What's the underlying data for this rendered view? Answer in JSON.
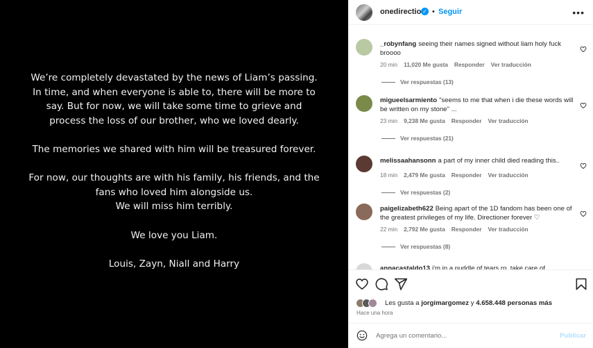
{
  "statement": {
    "paragraphs": [
      [
        "We’re completely devastated by the news of Liam’s passing.",
        "In time, and when everyone is able to, there will be more to",
        "say. But for now, we will take some time to grieve and",
        "process the loss of our brother, who we loved dearly."
      ],
      [
        "The memories we shared with him will be treasured forever."
      ],
      [
        "For now, our thoughts are with his family, his friends, and the",
        "fans who loved him alongside us.",
        "We will miss him terribly."
      ],
      [
        "We love you Liam."
      ],
      [
        "Louis, Zayn, Niall and Harry"
      ]
    ]
  },
  "header": {
    "username": "onedirection",
    "verified_glyph": "✓",
    "separator": "•",
    "follow_label": "Seguir",
    "more_glyph": "•••",
    "verified_color": "#0095f6"
  },
  "comments": [
    {
      "user": "_robynfang",
      "text": "seeing their names signed without liam holy fuck broooo",
      "time": "20 min",
      "likes": "11,020 Me gusta",
      "reply_label": "Responder",
      "translate_label": "Ver traducción",
      "replies": "Ver respuestas (13)",
      "avatar_color": "#b9c9a4",
      "icon": "heart-outline-icon"
    },
    {
      "user": "migueelsarmiento",
      "text": "\"seems to me that when i die these words will be written on my stone\" ...",
      "time": "23 min",
      "likes": "9,238 Me gusta",
      "reply_label": "Responder",
      "translate_label": "Ver traducción",
      "replies": "Ver respuestas (21)",
      "avatar_color": "#7a8a4a",
      "icon": "heart-outline-icon"
    },
    {
      "user": "melissaahansonn",
      "text": "a part of my inner child died reading this..",
      "time": "18 min",
      "likes": "2,479 Me gusta",
      "reply_label": "Responder",
      "translate_label": "Ver traducción",
      "replies": "Ver respuestas (2)",
      "avatar_color": "#5a3a32",
      "icon": "heart-outline-icon"
    },
    {
      "user": "paigelizabeth622",
      "text": "Being apart of the 1D fandom has been one of the greatest privileges of my life. Directioner forever ♡",
      "time": "22 min",
      "likes": "2,792 Me gusta",
      "reply_label": "Responder",
      "translate_label": "Ver traducción",
      "replies": "Ver respuestas (8)",
      "avatar_color": "#8a6a5a",
      "icon": "heart-outline-icon"
    },
    {
      "user": "annacastaldo13",
      "text": "i'm in a puddle of tears rn, take care of",
      "time": "",
      "likes": "",
      "reply_label": "",
      "translate_label": "",
      "replies": "",
      "avatar_color": "#d8d8d8",
      "icon": "heart-outline-icon"
    }
  ],
  "actions": {
    "like_icon": "heart-outline-icon",
    "comment_icon": "comment-bubble-icon",
    "share_icon": "paper-plane-icon",
    "save_icon": "bookmark-icon",
    "likes_prefix": "Les gusta a ",
    "likes_user": "jorgimargomez",
    "likes_mid": " y ",
    "likes_count": "4.658.448 personas más",
    "time_ago": "Hace una hora"
  },
  "add_comment": {
    "placeholder": "Agrega un comentario...",
    "post_label": "Publicar",
    "emoji_icon": "smiley-icon"
  }
}
